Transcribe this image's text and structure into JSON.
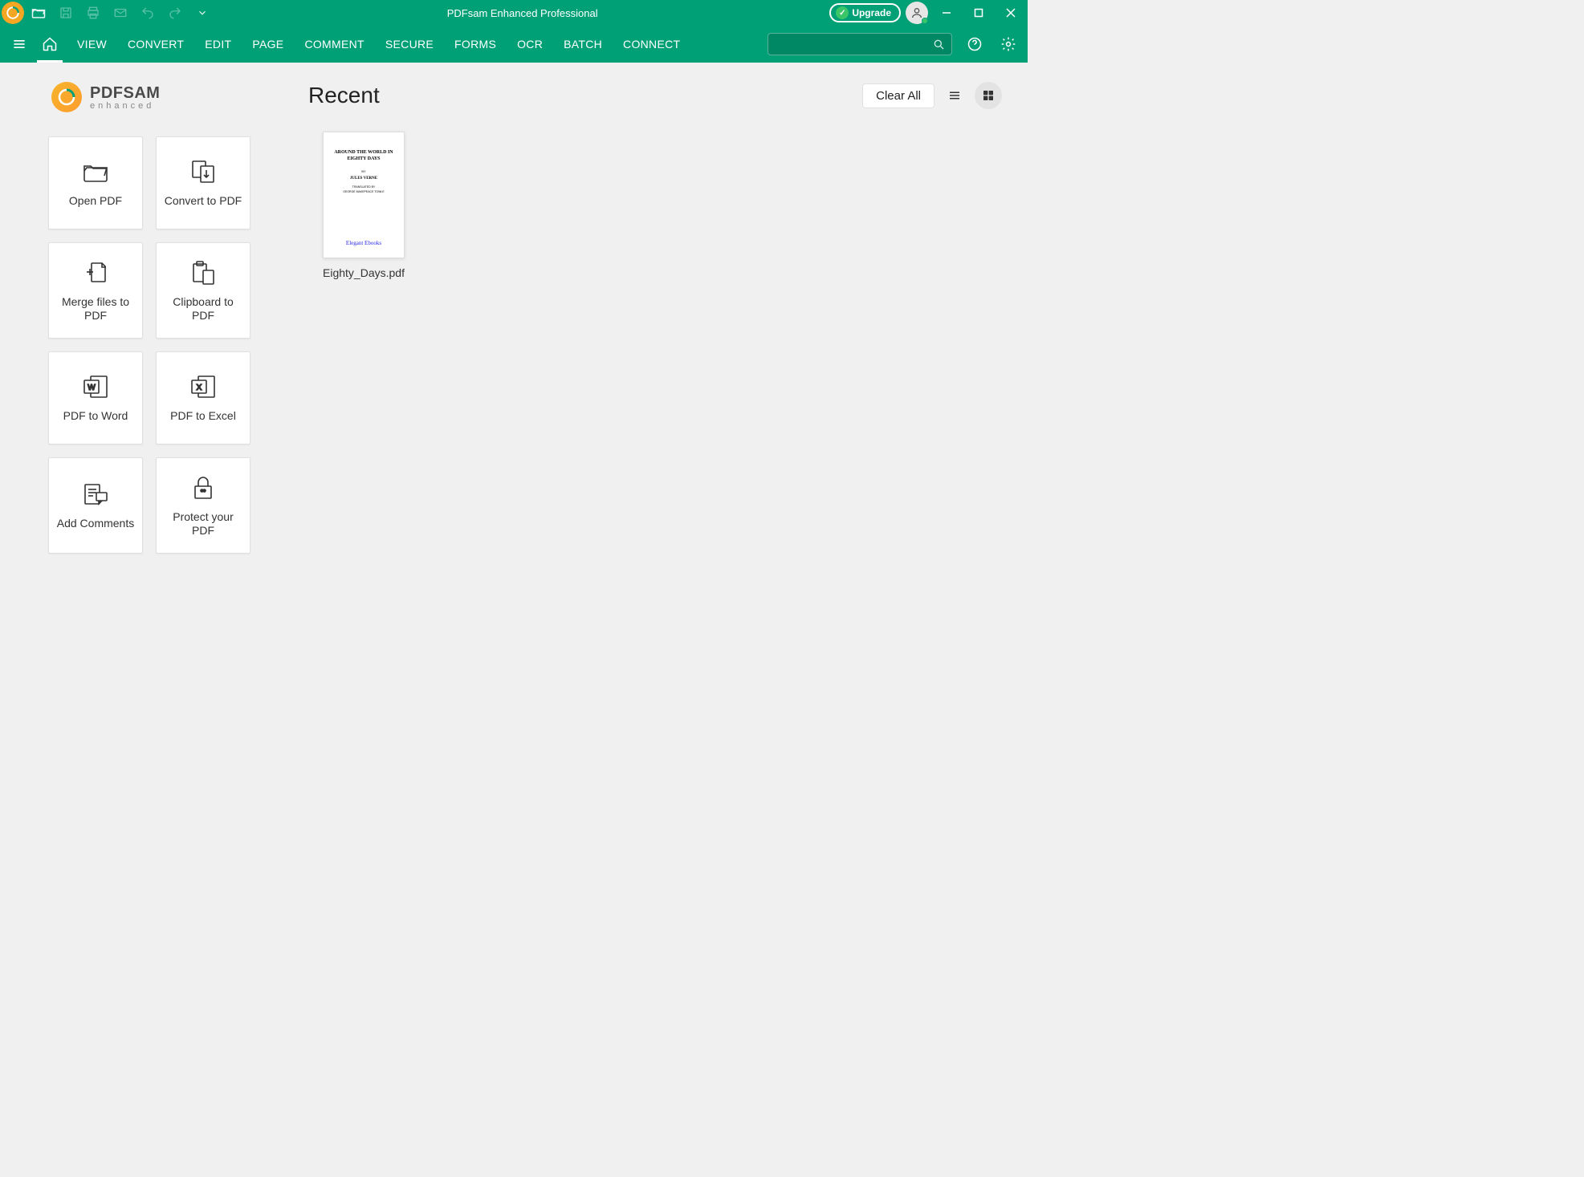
{
  "app_title": "PDFsam Enhanced Professional",
  "titlebar": {
    "upgrade_label": "Upgrade"
  },
  "menu": {
    "items": [
      "VIEW",
      "CONVERT",
      "EDIT",
      "PAGE",
      "COMMENT",
      "SECURE",
      "FORMS",
      "OCR",
      "BATCH",
      "CONNECT"
    ]
  },
  "brand": {
    "name": "PDFSAM",
    "sub": "enhanced"
  },
  "actions": [
    {
      "label": "Open PDF"
    },
    {
      "label": "Convert to PDF"
    },
    {
      "label": "Merge files to PDF"
    },
    {
      "label": "Clipboard to PDF"
    },
    {
      "label": "PDF to Word"
    },
    {
      "label": "PDF to Excel"
    },
    {
      "label": "Add Comments"
    },
    {
      "label": "Protect your PDF"
    }
  ],
  "recent": {
    "title": "Recent",
    "clear_label": "Clear All",
    "docs": [
      {
        "filename": "Eighty_Days.pdf",
        "thumb_lines": {
          "t1": "AROUND THE WORLD IN EIGHTY DAYS",
          "t2": "BY",
          "t3": "JULES VERNE",
          "t4": "TRANSLATED BY",
          "t5": "GEORGE MAKEPEACE TOWLE",
          "sig": "Elegant Ebooks"
        }
      }
    ]
  }
}
